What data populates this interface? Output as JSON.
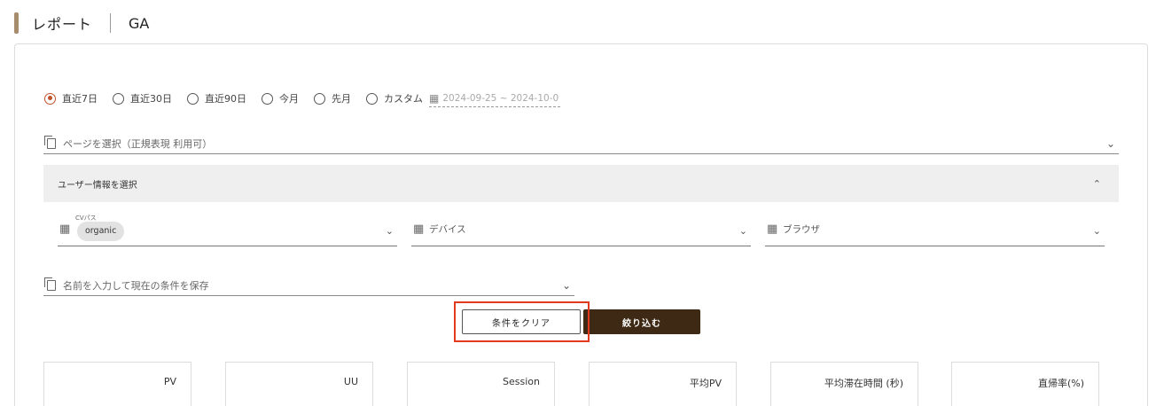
{
  "header": {
    "title": "レポート",
    "subtitle": "GA"
  },
  "period": {
    "options": [
      "直近7日",
      "直近30日",
      "直近90日",
      "今月",
      "先月",
      "カスタム"
    ],
    "selected_index": 0,
    "date_range": "2024-09-25 ~ 2024-10-0"
  },
  "page_select": {
    "placeholder": "ページを選択（正規表現 利用可）"
  },
  "user_info": {
    "label": "ユーザー情報を選択"
  },
  "filters": {
    "cv_path": {
      "small_label": "CVパス",
      "chip": "organic"
    },
    "device": {
      "label": "デバイス"
    },
    "browser": {
      "label": "ブラウザ"
    }
  },
  "save_condition": {
    "placeholder": "名前を入力して現在の条件を保存"
  },
  "buttons": {
    "clear": "条件をクリア",
    "apply": "絞り込む"
  },
  "cards": [
    "PV",
    "UU",
    "Session",
    "平均PV",
    "平均滞在時間 (秒)",
    "直帰率(%)"
  ]
}
